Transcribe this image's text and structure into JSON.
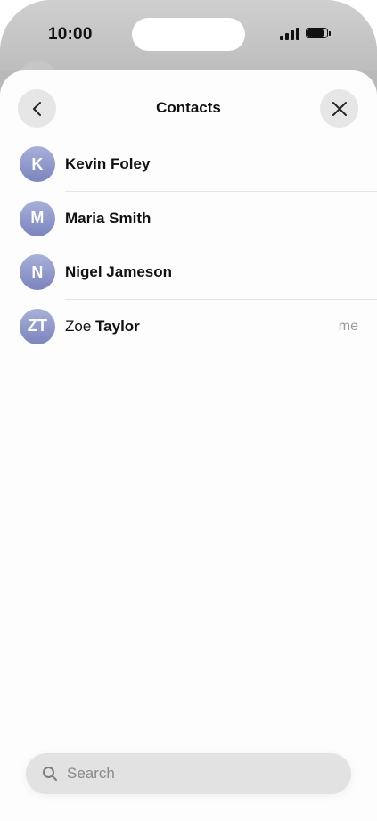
{
  "status_bar": {
    "time": "10:00"
  },
  "header": {
    "title": "Contacts",
    "back_icon": "chevron-left-icon",
    "close_icon": "close-icon"
  },
  "contacts": [
    {
      "initials": "K",
      "first": "Kevin",
      "last": "Foley",
      "me": ""
    },
    {
      "initials": "M",
      "first": "Maria",
      "last": "Smith",
      "me": ""
    },
    {
      "initials": "N",
      "first": "Nigel",
      "last": "Jameson",
      "me": ""
    },
    {
      "initials": "ZT",
      "first": "Zoe",
      "last": "Taylor",
      "me": "me"
    }
  ],
  "search": {
    "placeholder": "Search",
    "value": ""
  },
  "colors": {
    "avatar_gradient_top": "#a8b1d8",
    "avatar_gradient_bottom": "#7b84bd",
    "sheet_background": "#fdfdfd",
    "secondary_text": "#9a9a9a"
  }
}
